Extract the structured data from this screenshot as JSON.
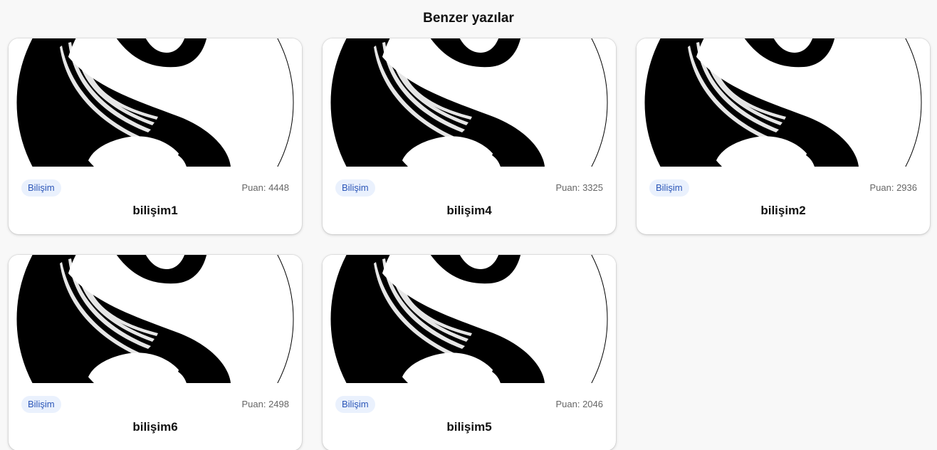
{
  "section": {
    "title": "Benzer yazılar"
  },
  "cards": [
    {
      "category": "Bilişim",
      "score": "Puan: 4448",
      "title": "bilişim1"
    },
    {
      "category": "Bilişim",
      "score": "Puan: 3325",
      "title": "bilişim4"
    },
    {
      "category": "Bilişim",
      "score": "Puan: 2936",
      "title": "bilişim2"
    },
    {
      "category": "Bilişim",
      "score": "Puan: 2498",
      "title": "bilişim6"
    },
    {
      "category": "Bilişim",
      "score": "Puan: 2046",
      "title": "bilişim5"
    }
  ],
  "colors": {
    "badge_bg": "#eaf1fd",
    "badge_text": "#2b56b8",
    "page_bg": "#f8f8f8"
  },
  "thumbnail_icon": "black-white-swirl-logo"
}
